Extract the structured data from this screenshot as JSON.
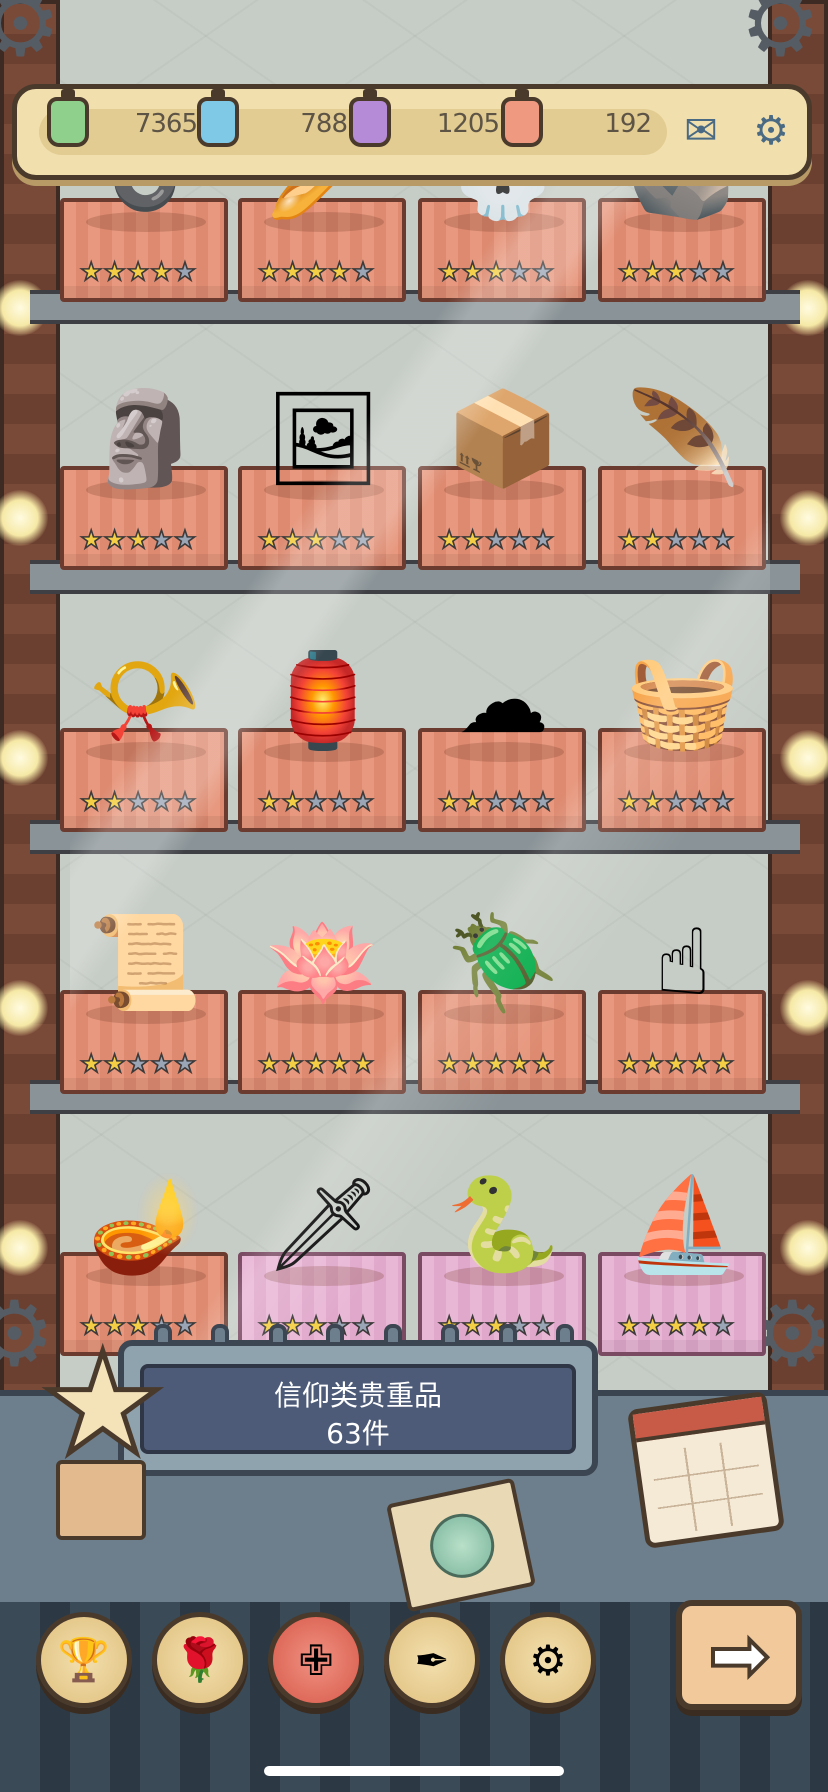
{
  "currencies": [
    {
      "icon": "green-ink-bottle-icon",
      "color": "#8fd18c",
      "value": "7365"
    },
    {
      "icon": "blue-ink-bottle-icon",
      "color": "#7fc8e6",
      "value": "788"
    },
    {
      "icon": "purple-ink-bottle-icon",
      "color": "#b58ad6",
      "value": "1205"
    },
    {
      "icon": "red-ink-bottle-icon",
      "color": "#ef9a80",
      "value": "192"
    }
  ],
  "top_icons": {
    "mail": "mail-icon",
    "settings": "gear-icon"
  },
  "shelves": [
    {
      "row": 0,
      "items": [
        {
          "name": "knot-relic",
          "stars": 4,
          "pink": false
        },
        {
          "name": "bread-relic",
          "stars": 4,
          "pink": false
        },
        {
          "name": "skull-relic",
          "stars": 3,
          "pink": false
        },
        {
          "name": "stone-relic",
          "stars": 3,
          "pink": false
        }
      ]
    },
    {
      "row": 1,
      "items": [
        {
          "name": "three-faced-bust",
          "stars": 3,
          "pink": false
        },
        {
          "name": "holy-shroud",
          "stars": 3,
          "pink": false
        },
        {
          "name": "golden-ark",
          "stars": 2,
          "pink": false
        },
        {
          "name": "golden-feather",
          "stars": 2,
          "pink": false
        }
      ]
    },
    {
      "row": 2,
      "items": [
        {
          "name": "golden-horn",
          "stars": 2,
          "pink": false
        },
        {
          "name": "lantern-relic",
          "stars": 2,
          "pink": false
        },
        {
          "name": "cloud-relic",
          "stars": 2,
          "pink": false
        },
        {
          "name": "bread-basket",
          "stars": 2,
          "pink": false
        }
      ]
    },
    {
      "row": 3,
      "items": [
        {
          "name": "painted-scroll",
          "stars": 2,
          "pink": false
        },
        {
          "name": "lotus-flame",
          "stars": 5,
          "pink": false
        },
        {
          "name": "jeweled-scarab",
          "stars": 5,
          "pink": false
        },
        {
          "name": "pointing-hand-statue",
          "stars": 5,
          "pink": false
        }
      ]
    },
    {
      "row": 4,
      "items": [
        {
          "name": "magic-lamp",
          "stars": 3,
          "pink": false
        },
        {
          "name": "flaming-sword",
          "stars": 3,
          "pink": true
        },
        {
          "name": "serpent-idol",
          "stars": 3,
          "pink": true
        },
        {
          "name": "sailing-ship",
          "stars": 4,
          "pink": true
        }
      ]
    }
  ],
  "sign": {
    "title": "信仰类贵重品",
    "count": "63件"
  },
  "nav": [
    {
      "name": "nav-trophy",
      "icon": "trophy-icon",
      "glyph": "🏆",
      "active": false
    },
    {
      "name": "nav-rose",
      "icon": "rose-icon",
      "glyph": "🌹",
      "active": false
    },
    {
      "name": "nav-cross",
      "icon": "cross-icon",
      "glyph": "✙",
      "active": true
    },
    {
      "name": "nav-quill",
      "icon": "quill-icon",
      "glyph": "✒",
      "active": false
    },
    {
      "name": "nav-gear",
      "icon": "gear-icon",
      "glyph": "⚙",
      "active": false
    }
  ],
  "next_icon": "arrow-right-icon"
}
